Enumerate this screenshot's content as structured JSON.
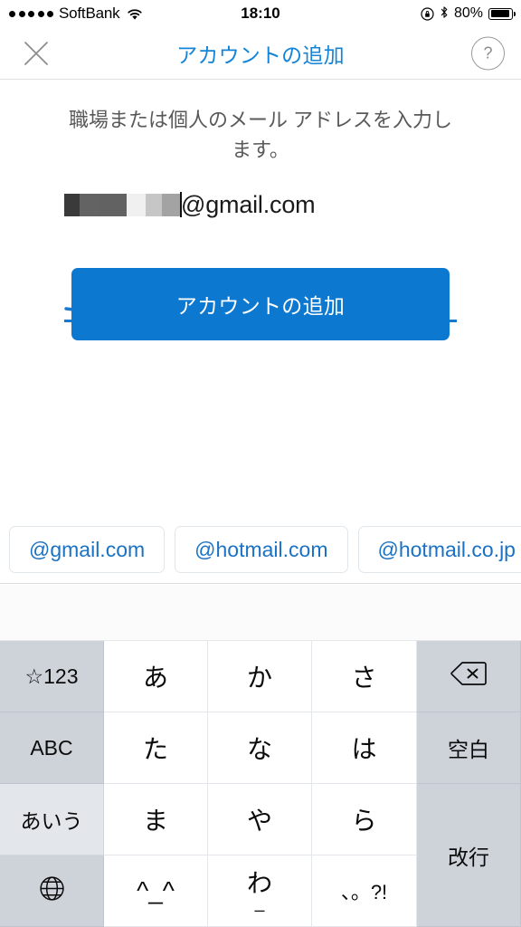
{
  "status_bar": {
    "signal_dots": 5,
    "carrier": "SoftBank",
    "wifi_icon": "wifi-icon",
    "time": "18:10",
    "rotation_lock_icon": "rotation-lock-icon",
    "bluetooth_icon": "bluetooth-icon",
    "battery_percent": "80%",
    "battery_level": 80
  },
  "nav_bar": {
    "close_icon": "close-icon",
    "title": "アカウントの追加",
    "help_label": "?",
    "title_color": "#1484d7"
  },
  "content": {
    "prompt": "職場または個人のメール アドレスを入力します。",
    "email_field": {
      "redacted_username": "",
      "visible_value": "@gmail.com",
      "redaction_blocks": [
        "#3a3a3a",
        "#636363",
        "#626262",
        "#f0f0f0",
        "#c6c6c6",
        "#a3a3a3"
      ],
      "underline_color": "#1b78cf",
      "caret_visible": true
    },
    "primary_button": {
      "label": "アカウントの追加",
      "color": "#0c78d0",
      "text_color": "#ffffff"
    }
  },
  "suggestions": {
    "chip_text_color": "#1b72c4",
    "items": [
      {
        "label": "@gmail.com"
      },
      {
        "label": "@hotmail.com"
      },
      {
        "label": "@hotmail.co.jp"
      },
      {
        "label": "@"
      }
    ]
  },
  "keyboard": {
    "type": "japanese-kana-10key",
    "rows": [
      [
        {
          "label": "☆123",
          "kind": "fn",
          "name": "key-symbols-numbers"
        },
        {
          "label": "あ",
          "kind": "kana",
          "name": "key-kana-a"
        },
        {
          "label": "か",
          "kind": "kana",
          "name": "key-kana-ka"
        },
        {
          "label": "さ",
          "kind": "kana",
          "name": "key-kana-sa"
        },
        {
          "label": "",
          "kind": "icon-delete",
          "name": "key-delete"
        }
      ],
      [
        {
          "label": "ABC",
          "kind": "fn",
          "name": "key-abc"
        },
        {
          "label": "た",
          "kind": "kana",
          "name": "key-kana-ta"
        },
        {
          "label": "な",
          "kind": "kana",
          "name": "key-kana-na"
        },
        {
          "label": "は",
          "kind": "kana",
          "name": "key-kana-ha"
        },
        {
          "label": "空白",
          "kind": "fn",
          "name": "key-space"
        }
      ],
      [
        {
          "label": "あいう",
          "kind": "fn-active",
          "name": "key-kana-mode"
        },
        {
          "label": "ま",
          "kind": "kana",
          "name": "key-kana-ma"
        },
        {
          "label": "や",
          "kind": "kana",
          "name": "key-kana-ya"
        },
        {
          "label": "ら",
          "kind": "kana",
          "name": "key-kana-ra"
        },
        {
          "label": "改行",
          "kind": "fn-tall",
          "name": "key-return"
        }
      ],
      [
        {
          "label": "",
          "kind": "icon-globe",
          "name": "key-globe"
        },
        {
          "label": "^_^",
          "kind": "kana",
          "name": "key-emoticon"
        },
        {
          "label": "わ",
          "sub": "_",
          "kind": "kana-sub",
          "name": "key-kana-wa"
        },
        {
          "label": "、。?!",
          "kind": "kana-small",
          "name": "key-punctuation"
        }
      ]
    ]
  }
}
